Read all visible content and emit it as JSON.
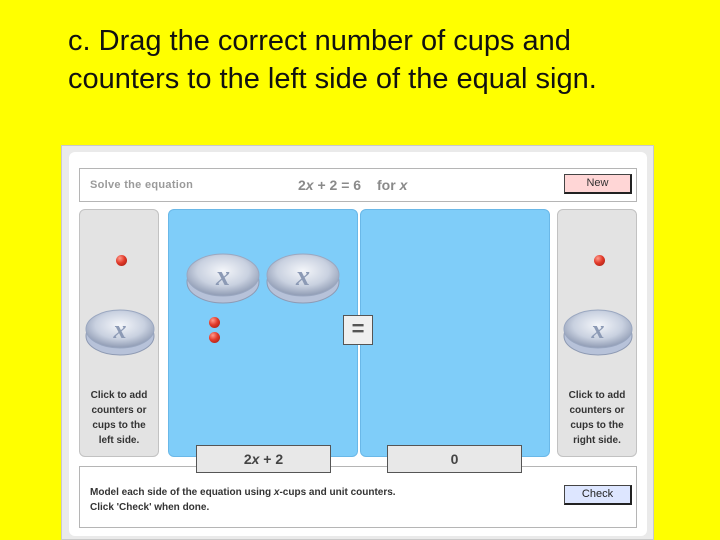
{
  "slide": {
    "title_prefix": "c.",
    "title_line1": " Drag the correct number of cups and",
    "title_line2": "counters to the left side of the equal sign."
  },
  "header": {
    "solve_label": "Solve the equation",
    "equation_coef": "2",
    "equation_var": "x",
    "equation_rest": " + 2 = 6",
    "for_text": "for ",
    "for_var": "x",
    "new_button": "New"
  },
  "left_panel": {
    "caption": "Click to add counters or cups to the left side."
  },
  "right_panel": {
    "caption": "Click to add counters or cups to the right side."
  },
  "cup_label": "x",
  "equal_sign": "=",
  "left_expression": {
    "coef": "2",
    "var": "x",
    "rest": " + 2"
  },
  "right_expression": "0",
  "footer": {
    "instr_line1_a": "Model each side of the equation using ",
    "instr_line1_var": "x",
    "instr_line1_b": "-cups and unit counters.",
    "instr_line2": "Click 'Check' when done.",
    "check_button": "Check"
  },
  "colors": {
    "slide_background": "#ffff00",
    "board_blue": "#7fcdf9",
    "new_button": "#ffd6d6",
    "check_button": "#dde6ff",
    "counter_red": "#e23a2a"
  },
  "board_state": {
    "left_cups": 2,
    "left_counters": 2,
    "right_cups": 0,
    "right_counters": 0
  }
}
